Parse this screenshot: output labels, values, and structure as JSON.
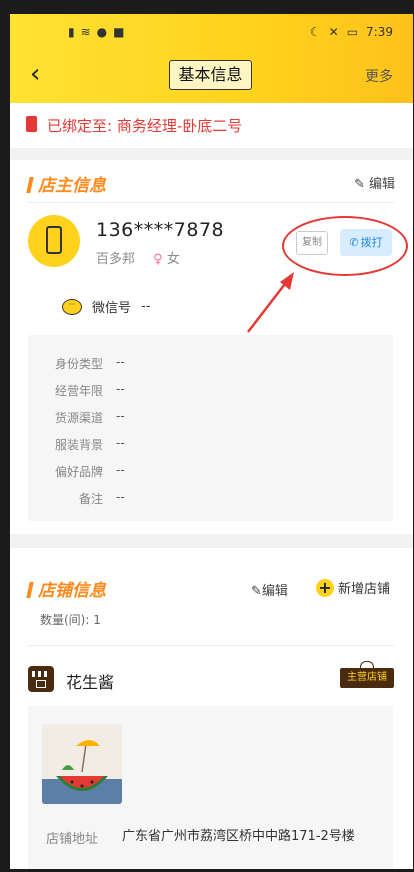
{
  "status_bar": {
    "time": "7:39"
  },
  "header": {
    "back_icon": "chevron-left-icon",
    "title": "基本信息",
    "more": "更多"
  },
  "bind_notice": {
    "icon": "phone-red-icon",
    "text": "已绑定至: 商务经理-卧底二号"
  },
  "owner": {
    "section_title": "店主信息",
    "edit_label": "编辑",
    "phone": "136****7878",
    "name": "百多邦",
    "gender_symbol": "♀",
    "gender": "女",
    "copy_label": "复制",
    "dial_label": "拨打",
    "wechat_label": "微信号",
    "wechat_value": "--",
    "info_rows": [
      {
        "key": "身份类型",
        "value": "--"
      },
      {
        "key": "经营年限",
        "value": "--"
      },
      {
        "key": "货源渠道",
        "value": "--"
      },
      {
        "key": "服装背景",
        "value": "--"
      },
      {
        "key": "偏好品牌",
        "value": "--"
      },
      {
        "key": "备注",
        "value": "--"
      }
    ]
  },
  "shop": {
    "section_title": "店铺信息",
    "edit_label": "编辑",
    "add_label": "新增店铺",
    "count": "数量(间): 1",
    "shop_name": "花生酱",
    "badge": "主营店铺",
    "address_label": "店铺地址",
    "address": "广东省广州市荔湾区桥中中路171-2号楼"
  },
  "colors": {
    "accent_yellow": "#ffd21e",
    "accent_orange": "#ff8a1e",
    "alert_red": "#e53935",
    "dial_blue": "#1e88e5"
  }
}
